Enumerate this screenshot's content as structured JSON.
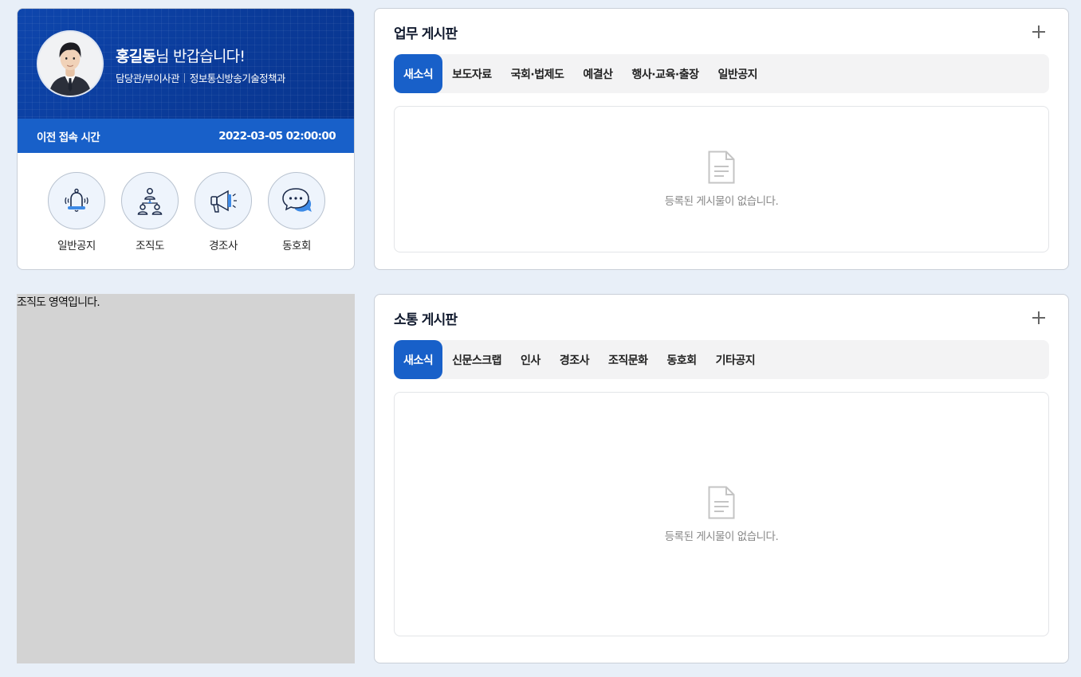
{
  "profile": {
    "name": "홍길동",
    "greeting_suffix": "님 반갑습니다!",
    "position": "담당관/부이사관",
    "department": "정보통신방송기술정책과",
    "last_login_label": "이전 접속 시간",
    "last_login_value": "2022-03-05 02:00:00"
  },
  "quick_menu": [
    {
      "label": "일반공지",
      "icon": "bell-icon"
    },
    {
      "label": "조직도",
      "icon": "org-chart-icon"
    },
    {
      "label": "경조사",
      "icon": "megaphone-icon"
    },
    {
      "label": "동호회",
      "icon": "chat-bubble-icon"
    }
  ],
  "work_board": {
    "title": "업무 게시판",
    "tabs": [
      "새소식",
      "보도자료",
      "국회·법제도",
      "예결산",
      "행사·교육·출장",
      "일반공지"
    ],
    "active_tab": "새소식",
    "empty_message": "등록된 게시물이 없습니다."
  },
  "comm_board": {
    "title": "소통 게시판",
    "tabs": [
      "새소식",
      "신문스크랩",
      "인사",
      "경조사",
      "조직문화",
      "동호회",
      "기타공지"
    ],
    "active_tab": "새소식",
    "empty_message": "등록된 게시물이 없습니다."
  },
  "org_area": {
    "text": "조직도 영역입니다."
  },
  "colors": {
    "page_bg": "#e8eff8",
    "profile_bg": "#0a3c9c",
    "accent": "#1860c9",
    "tab_bg": "#f3f3f4"
  }
}
